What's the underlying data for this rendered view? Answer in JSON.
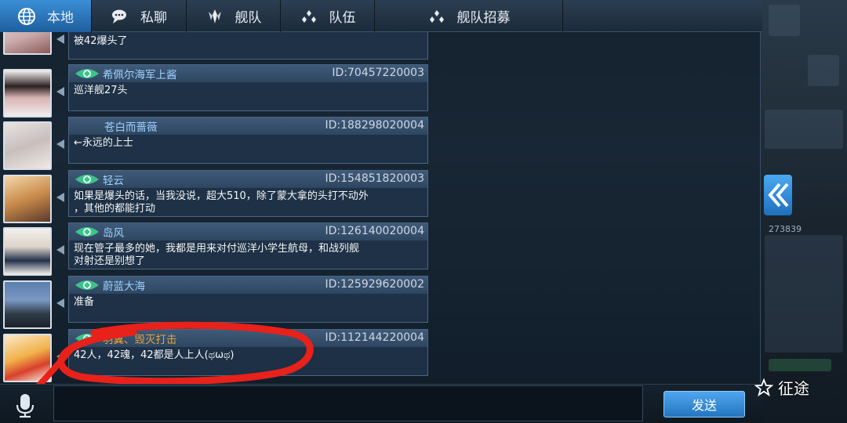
{
  "tabs": [
    {
      "label": "本地",
      "icon": "globe-icon",
      "active": true
    },
    {
      "label": "私聊",
      "icon": "chat-bubble-icon",
      "active": false
    },
    {
      "label": "舰队",
      "icon": "fleet-emblem-icon",
      "active": false
    },
    {
      "label": "队伍",
      "icon": "team-dots-icon",
      "active": false
    },
    {
      "label": "舰队招募",
      "icon": "recruit-dots-icon",
      "active": false
    }
  ],
  "messages": [
    {
      "name": "",
      "id": "",
      "text": "被42爆头了"
    },
    {
      "name": "希佩尔海军上酱",
      "id": "ID:70457220003",
      "text": "巡洋舰27头"
    },
    {
      "name": "苍白而蔷薇",
      "id": "ID:188298020004",
      "text": "←永远的上士"
    },
    {
      "name": "轻云",
      "id": "ID:154851820003",
      "text": "如果是爆头的话，当我没说，超大510，除了蒙大拿的头打不动外\n，其他的都能打动"
    },
    {
      "name": "岛风",
      "id": "ID:126140020004",
      "text": "现在管子最多的她，我都是用来对付巡洋小学生航母，和战列舰\n对射还是别想了"
    },
    {
      "name": "蔚蓝大海",
      "id": "ID:125929620002",
      "text": "准备"
    },
    {
      "name": "羽翼、毁灭打击",
      "id": "ID:112144220004",
      "text": "42人，42魂，42都是人上人(ಥωಥ)"
    }
  ],
  "input": {
    "send_label": "发送"
  },
  "watermark": {
    "label": "征途"
  },
  "right_panel": {
    "number": "273839"
  },
  "colors": {
    "accent": "#2f7fcc",
    "name_blue": "#9fd2ff",
    "name_gold": "#e7a13a",
    "annotation_red": "#e8211b"
  }
}
